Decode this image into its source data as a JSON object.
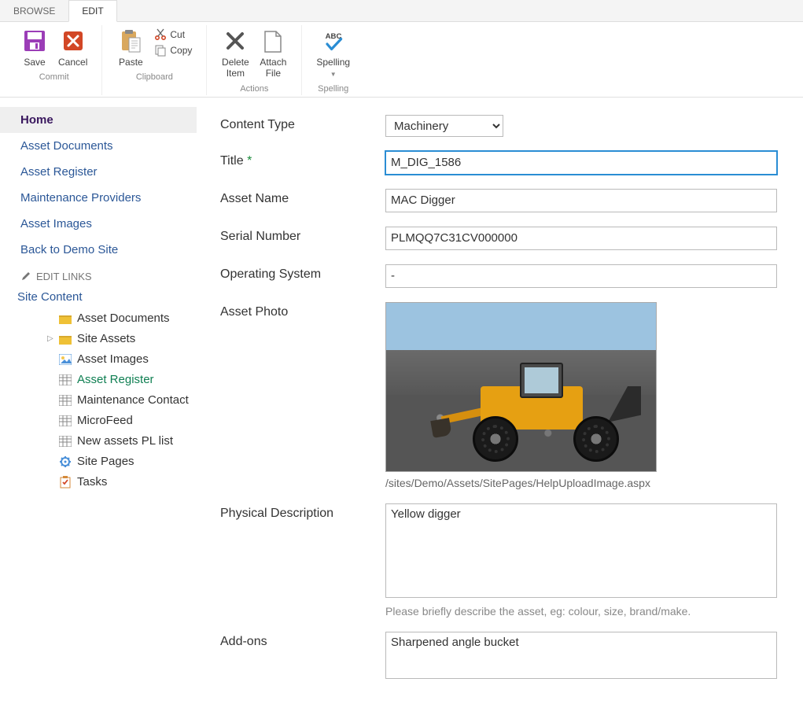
{
  "tabs": {
    "browse": "BROWSE",
    "edit": "EDIT"
  },
  "ribbon": {
    "save": "Save",
    "cancel": "Cancel",
    "commit_group": "Commit",
    "paste": "Paste",
    "cut": "Cut",
    "copy": "Copy",
    "clipboard_group": "Clipboard",
    "delete_item": "Delete\nItem",
    "attach_file": "Attach\nFile",
    "actions_group": "Actions",
    "spelling": "Spelling",
    "spelling_group": "Spelling"
  },
  "sidebar": {
    "home": "Home",
    "asset_documents": "Asset Documents",
    "asset_register": "Asset Register",
    "maintenance_providers": "Maintenance Providers",
    "asset_images": "Asset Images",
    "back_to_demo": "Back to Demo Site",
    "edit_links": "EDIT LINKS",
    "site_content": "Site Content",
    "tree": {
      "asset_documents": "Asset Documents",
      "site_assets": "Site Assets",
      "asset_images": "Asset Images",
      "asset_register": "Asset Register",
      "maintenance_contact": "Maintenance Contact",
      "microfeed": "MicroFeed",
      "new_assets_pl": "New assets PL list",
      "site_pages": "Site Pages",
      "tasks": "Tasks"
    }
  },
  "form": {
    "content_type_label": "Content Type",
    "content_type_value": "Machinery",
    "title_label": "Title",
    "title_value": "M_DIG_1586",
    "asset_name_label": "Asset Name",
    "asset_name_value": "MAC Digger",
    "serial_label": "Serial Number",
    "serial_value": "PLMQQ7C31CV000000",
    "os_label": "Operating System",
    "os_value": "-",
    "photo_label": "Asset Photo",
    "photo_path": "/sites/Demo/Assets/SitePages/HelpUploadImage.aspx",
    "phys_desc_label": "Physical Description",
    "phys_desc_value": "Yellow digger",
    "phys_desc_help": "Please briefly describe the asset, eg: colour, size, brand/make.",
    "addons_label": "Add-ons",
    "addons_value": "Sharpened angle bucket"
  }
}
